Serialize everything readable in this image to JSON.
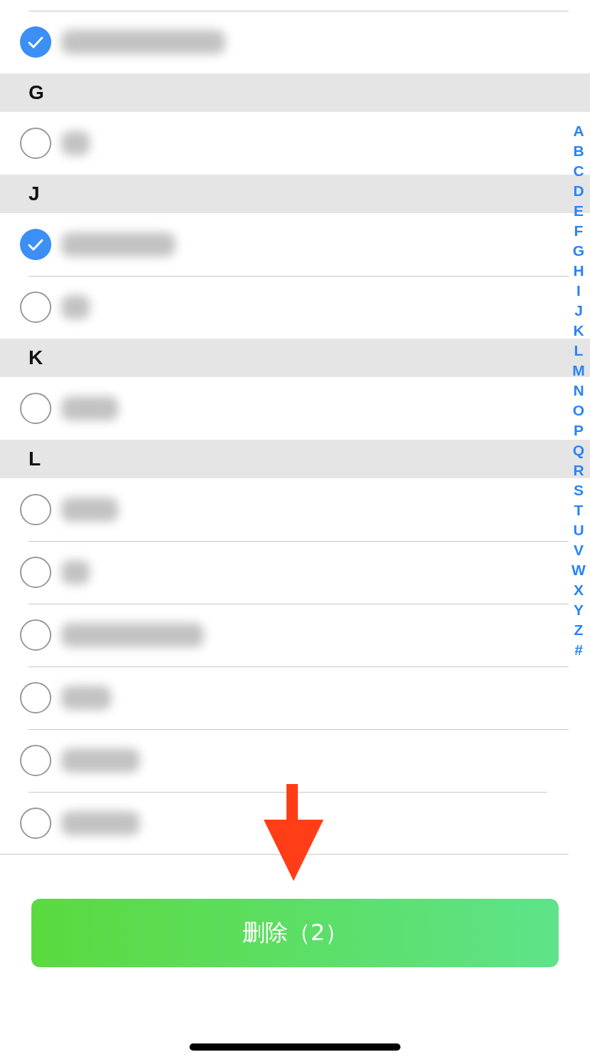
{
  "sections": [
    {
      "contacts": [
        {
          "selected": true
        }
      ]
    },
    {
      "letter": "G",
      "contacts": [
        {
          "selected": false
        }
      ]
    },
    {
      "letter": "J",
      "contacts": [
        {
          "selected": true
        },
        {
          "selected": false
        }
      ]
    },
    {
      "letter": "K",
      "contacts": [
        {
          "selected": false
        }
      ]
    },
    {
      "letter": "L",
      "contacts": [
        {
          "selected": false
        },
        {
          "selected": false
        },
        {
          "selected": false
        },
        {
          "selected": false
        },
        {
          "selected": false
        },
        {
          "selected": false
        }
      ]
    }
  ],
  "index_bar": [
    "A",
    "B",
    "C",
    "D",
    "E",
    "F",
    "G",
    "H",
    "I",
    "J",
    "K",
    "L",
    "M",
    "N",
    "O",
    "P",
    "Q",
    "R",
    "S",
    "T",
    "U",
    "V",
    "W",
    "X",
    "Y",
    "Z",
    "#"
  ],
  "delete_button": {
    "label": "删除（2）"
  }
}
